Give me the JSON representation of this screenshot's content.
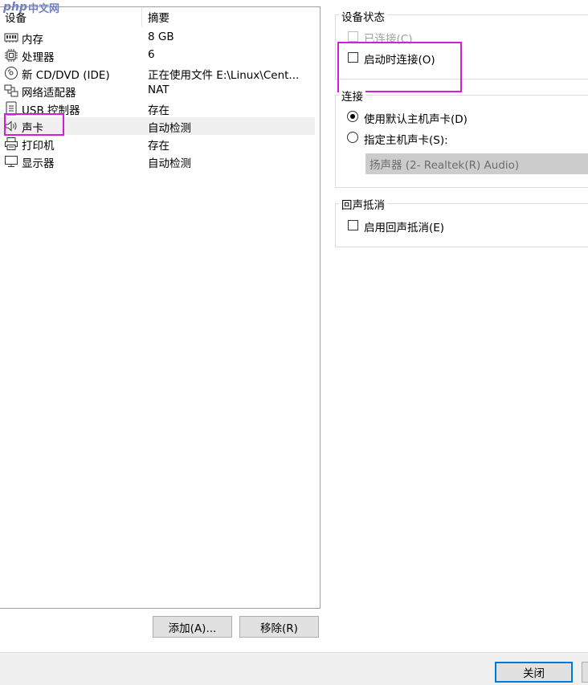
{
  "watermark": {
    "php": "php",
    "site": "中文网"
  },
  "device_list": {
    "headers": {
      "device": "设备",
      "summary": "摘要"
    },
    "items": [
      {
        "icon": "memory-icon",
        "name": "内存",
        "summary": "8 GB"
      },
      {
        "icon": "processor-icon",
        "name": "处理器",
        "summary": "6"
      },
      {
        "icon": "cd-dvd-icon",
        "name": "新 CD/DVD (IDE)",
        "summary": "正在使用文件 E:\\Linux\\Cent..."
      },
      {
        "icon": "network-adapter-icon",
        "name": "网络适配器",
        "summary": "NAT"
      },
      {
        "icon": "usb-controller-icon",
        "name": "USB 控制器",
        "summary": "存在"
      },
      {
        "icon": "sound-card-icon",
        "name": "声卡",
        "summary": "自动检测"
      },
      {
        "icon": "printer-icon",
        "name": "打印机",
        "summary": "存在"
      },
      {
        "icon": "display-icon",
        "name": "显示器",
        "summary": "自动检测"
      }
    ],
    "selected_index": 5,
    "add_button": "添加(A)...",
    "remove_button": "移除(R)"
  },
  "device_status": {
    "title": "设备状态",
    "connected_label": "已连接(C)",
    "connected_checked": false,
    "connected_enabled": false,
    "connect_on_power_label": "启动时连接(O)",
    "connect_on_power_checked": false
  },
  "connection": {
    "title": "连接",
    "use_default_label": "使用默认主机声卡(D)",
    "specify_label": "指定主机声卡(S):",
    "selected_option": "use_default",
    "host_card_value": "扬声器 (2- Realtek(R) Audio)"
  },
  "echo_cancellation": {
    "title": "回声抵消",
    "enable_label": "启用回声抵消(E)",
    "enable_checked": false
  },
  "footer": {
    "close_button": "关闭"
  },
  "annotation_color": "#d21ed8"
}
